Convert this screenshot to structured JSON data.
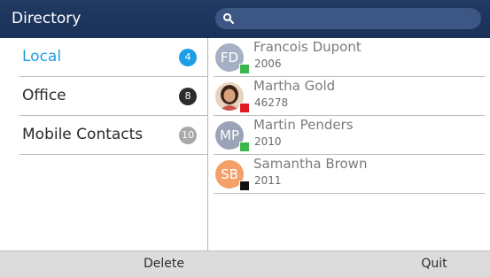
{
  "header": {
    "title": "Directory",
    "search_icon": "search-icon"
  },
  "categories": [
    {
      "label": "Local",
      "count": "4",
      "active": true,
      "badge_color": "#1d9ee6"
    },
    {
      "label": "Office",
      "count": "8",
      "active": false,
      "badge_color": "#2c2c2c"
    },
    {
      "label": "Mobile Contacts",
      "count": "10",
      "active": false,
      "badge_color": "#a9a9a9"
    }
  ],
  "contacts": [
    {
      "name": "Francois Dupont",
      "number": "2006",
      "initials": "FD",
      "avatar_color": "#a6b0c4",
      "presence": "available",
      "presence_color": "#3cb54a"
    },
    {
      "name": "Martha Gold",
      "number": "46278",
      "initials": "",
      "avatar_color": "#e7d3bf",
      "presence": "busy",
      "presence_color": "#e11b22"
    },
    {
      "name": "Martin Penders",
      "number": "2010",
      "initials": "MP",
      "avatar_color": "#9aa3b8",
      "presence": "available",
      "presence_color": "#3cb54a"
    },
    {
      "name": "Samantha Brown",
      "number": "2011",
      "initials": "SB",
      "avatar_color": "#f4a06a",
      "presence": "unknown",
      "presence_color": "#111111"
    }
  ],
  "softkeys": {
    "left": "Delete",
    "right": "Quit"
  }
}
